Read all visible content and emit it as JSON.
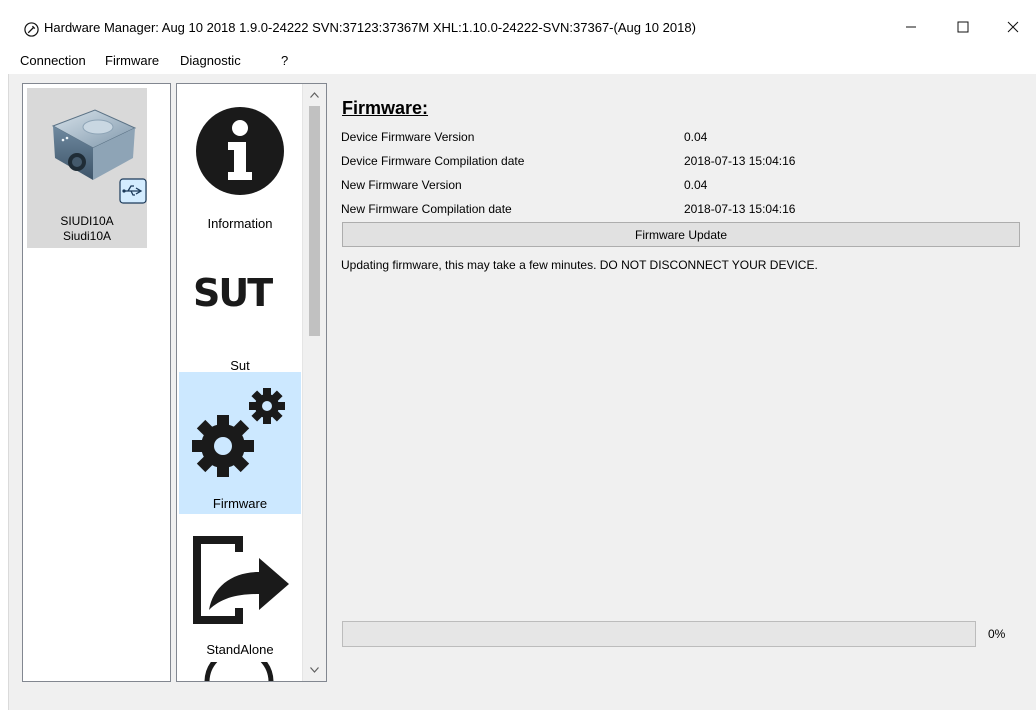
{
  "window": {
    "title": "Hardware Manager: Aug 10 2018 1.9.0-24222 SVN:37123:37367M XHL:1.10.0-24222-SVN:37367-(Aug 10 2018)",
    "minimize_icon": "minimize-icon",
    "maximize_icon": "maximize-icon",
    "close_icon": "close-icon"
  },
  "menu": {
    "items": [
      "Connection",
      "Firmware",
      "Diagnostic",
      "?"
    ]
  },
  "devices": [
    {
      "name": "SIUDI10A",
      "subname": "Siudi10A",
      "icon": "dmx-interface-device-icon",
      "badge_icon": "usb-icon"
    }
  ],
  "plugins": [
    {
      "label": "Information",
      "icon": "info-icon",
      "selected": false
    },
    {
      "label": "Sut",
      "icon": "sut-logo-icon",
      "selected": false
    },
    {
      "label": "Firmware",
      "icon": "gears-icon",
      "selected": true
    },
    {
      "label": "StandAlone",
      "icon": "export-arrow-icon",
      "selected": false
    }
  ],
  "firmware": {
    "title": "Firmware:",
    "rows": [
      {
        "label": "Device Firmware Version",
        "value": "0.04"
      },
      {
        "label": "Device Firmware Compilation date",
        "value": "2018-07-13 15:04:16"
      },
      {
        "label": "New Firmware Version",
        "value": "0.04"
      },
      {
        "label": "New Firmware Compilation date",
        "value": "2018-07-13 15:04:16"
      }
    ],
    "update_button": "Firmware Update",
    "status": "Updating firmware, this may take a few minutes. DO NOT DISCONNECT YOUR DEVICE.",
    "progress_percent": 0,
    "progress_text": "0%"
  },
  "colors": {
    "selected_bg": "#cce8ff",
    "client_bg": "#f0f0f0",
    "icon_dark": "#1a1a1a"
  }
}
